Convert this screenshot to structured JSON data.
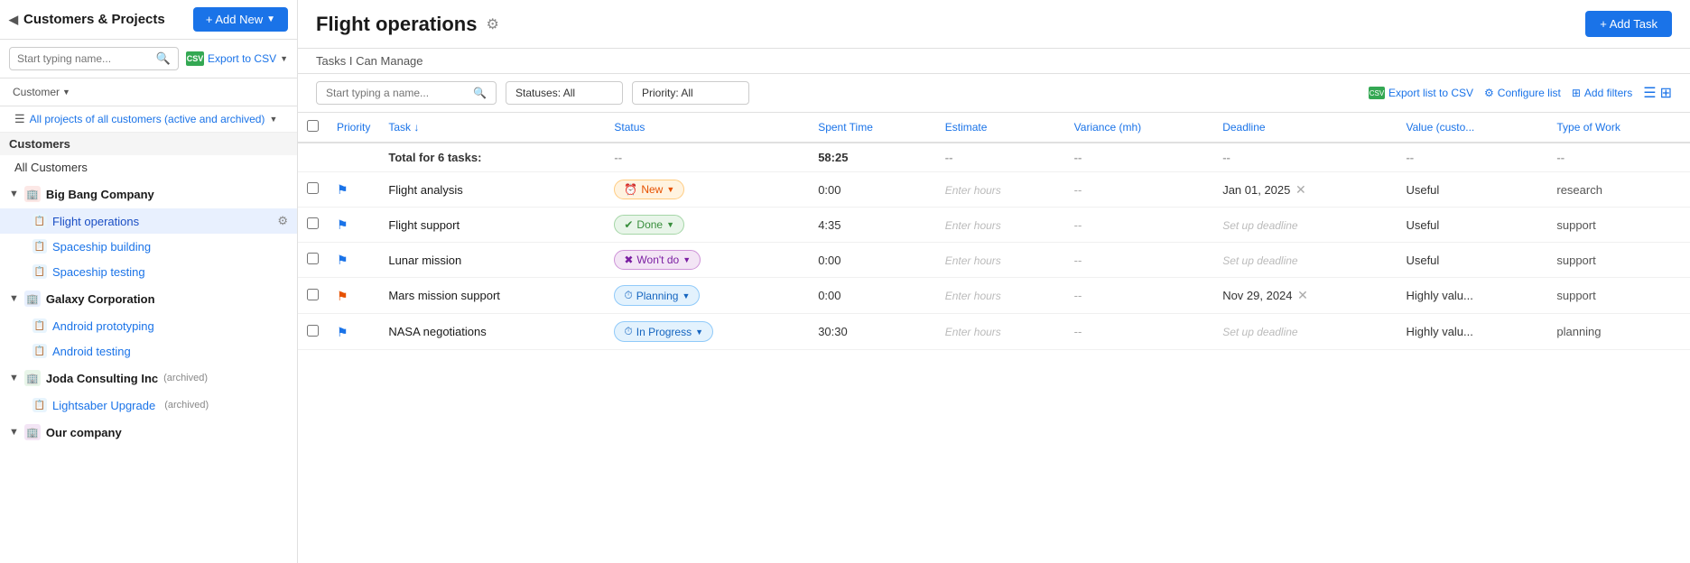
{
  "sidebar": {
    "title": "Customers & Projects",
    "collapse_icon": "◀",
    "add_new_label": "+ Add New",
    "search_placeholder": "Start typing name...",
    "export_label": "Export to CSV",
    "filter_label": "Customer",
    "all_projects_label": "All projects of all customers (active and archived)",
    "customers_header": "Customers",
    "all_customers_label": "All Customers",
    "companies": [
      {
        "name": "Big Bang Company",
        "projects": [
          {
            "label": "Flight operations",
            "active": true
          },
          {
            "label": "Spaceship building",
            "active": false
          },
          {
            "label": "Spaceship testing",
            "active": false
          }
        ]
      },
      {
        "name": "Galaxy Corporation",
        "projects": [
          {
            "label": "Android prototyping",
            "active": false
          },
          {
            "label": "Android testing",
            "active": false
          }
        ]
      },
      {
        "name": "Joda Consulting Inc",
        "archived": true,
        "projects": [
          {
            "label": "Lightsaber Upgrade",
            "archived": true,
            "active": false
          }
        ]
      },
      {
        "name": "Our company",
        "projects": []
      }
    ]
  },
  "main": {
    "title": "Flight operations",
    "subtitle": "Tasks I Can Manage",
    "add_task_label": "+ Add Task",
    "search_placeholder": "Start typing a name...",
    "statuses_filter": "Statuses:  All",
    "priority_filter": "Priority:  All",
    "export_label": "Export list to CSV",
    "configure_label": "Configure list",
    "add_filters_label": "Add filters",
    "columns": [
      {
        "key": "priority",
        "label": "Priority"
      },
      {
        "key": "task",
        "label": "Task ↓"
      },
      {
        "key": "status",
        "label": "Status"
      },
      {
        "key": "spent_time",
        "label": "Spent Time"
      },
      {
        "key": "estimate",
        "label": "Estimate"
      },
      {
        "key": "variance",
        "label": "Variance (mh)"
      },
      {
        "key": "deadline",
        "label": "Deadline"
      },
      {
        "key": "value",
        "label": "Value (custo..."
      },
      {
        "key": "type",
        "label": "Type of Work"
      }
    ],
    "total_row": {
      "label": "Total for 6 tasks:",
      "spent_time": "58:25"
    },
    "tasks": [
      {
        "name": "Flight analysis",
        "priority_flag": "blue",
        "status": "New",
        "status_type": "new",
        "spent_time": "0:00",
        "estimate": "Enter hours",
        "variance": "--",
        "deadline": "Jan 01, 2025",
        "deadline_has_x": true,
        "value": "Useful",
        "type": "research"
      },
      {
        "name": "Flight support",
        "priority_flag": "blue",
        "status": "Done",
        "status_type": "done",
        "spent_time": "4:35",
        "estimate": "Enter hours",
        "variance": "--",
        "deadline": "Set up deadline",
        "deadline_has_x": false,
        "value": "Useful",
        "type": "support"
      },
      {
        "name": "Lunar mission",
        "priority_flag": "blue",
        "status": "Won't do",
        "status_type": "wontdo",
        "spent_time": "0:00",
        "estimate": "Enter hours",
        "variance": "--",
        "deadline": "Set up deadline",
        "deadline_has_x": false,
        "value": "Useful",
        "type": "support"
      },
      {
        "name": "Mars mission support",
        "priority_flag": "orange",
        "status": "Planning",
        "status_type": "planning",
        "spent_time": "0:00",
        "estimate": "Enter hours",
        "variance": "--",
        "deadline": "Nov 29, 2024",
        "deadline_has_x": true,
        "value": "Highly valu...",
        "type": "support"
      },
      {
        "name": "NASA negotiations",
        "priority_flag": "blue",
        "status": "In Progress",
        "status_type": "inprogress",
        "spent_time": "30:30",
        "estimate": "Enter hours",
        "variance": "--",
        "deadline": "Set up deadline",
        "deadline_has_x": false,
        "value": "Highly valu...",
        "type": "planning"
      }
    ]
  }
}
